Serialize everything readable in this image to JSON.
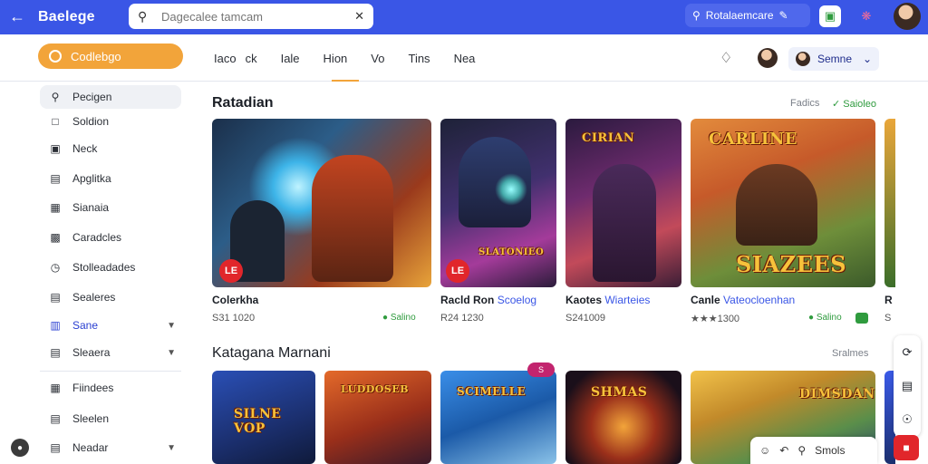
{
  "app": {
    "title": "Baelege"
  },
  "search": {
    "placeholder": "Dagecalee tamcam",
    "right_pill": "Rotalaemcare"
  },
  "category_button": {
    "label": "Codlebgo"
  },
  "tabs": [
    "Iaco",
    "ck",
    "Iale",
    "Hion",
    "Vo",
    "Tins",
    "Nea"
  ],
  "account": {
    "label": "Semne"
  },
  "sidebar": {
    "items": [
      {
        "label": "Pecigen",
        "icon": "search-icon"
      },
      {
        "label": "Soldion",
        "icon": "folder-icon"
      },
      {
        "label": "Neck",
        "icon": "download-icon"
      },
      {
        "label": "Apglitka",
        "icon": "document-icon"
      },
      {
        "label": "Sianaia",
        "icon": "grid-icon"
      },
      {
        "label": "Caradcles",
        "icon": "card-icon"
      },
      {
        "label": "Stolleadades",
        "icon": "clock-icon"
      },
      {
        "label": "Sealeres",
        "icon": "list-icon"
      },
      {
        "label": "Sane",
        "icon": "bar-chart-icon"
      },
      {
        "label": "Sleaera",
        "icon": "book-icon"
      },
      {
        "label": "Fiindees",
        "icon": "table-icon"
      },
      {
        "label": "Sleelen",
        "icon": "shield-icon"
      },
      {
        "label": "Neadar",
        "icon": "calendar-icon"
      }
    ]
  },
  "section1": {
    "title": "Ratadian",
    "link": "Fadics",
    "link2": "Saioleo",
    "cards": [
      {
        "title_bold": "Colerkha",
        "title_light": "",
        "meta": "S31 1020",
        "status": "Salino",
        "badge": "LE"
      },
      {
        "title_bold": "Racld Ron",
        "title_light": "Scoelog",
        "meta": "R24 1230",
        "status": "",
        "badge": "LE"
      },
      {
        "title_bold": "Kaotes",
        "title_light": "Wiarteies",
        "meta": "S241009",
        "status": ""
      },
      {
        "title_bold": "Canle",
        "title_light": "Vateocloenhan",
        "meta": "★★★1300",
        "status": "Salino"
      },
      {
        "title_bold": "R",
        "title_light": "",
        "meta": "S",
        "status": ""
      }
    ],
    "art_text": [
      "SLATONIEO",
      "CIRIAN",
      "CARLINE",
      "SIAZEES"
    ]
  },
  "section2": {
    "title": "Katagana Marnani",
    "link": "Sralmes",
    "art_text": [
      "SILNE VOP",
      "LUDDOSEB",
      "SCIMELLE",
      "SHMAS",
      "DIMSDAN"
    ],
    "ribbon": "S"
  },
  "bottom_bar": {
    "label": "Smols"
  },
  "colors": {
    "topbar": "#3a56e6",
    "accent": "#f2a43a",
    "badge": "#e1262b",
    "link_green": "#2f9b3e"
  }
}
